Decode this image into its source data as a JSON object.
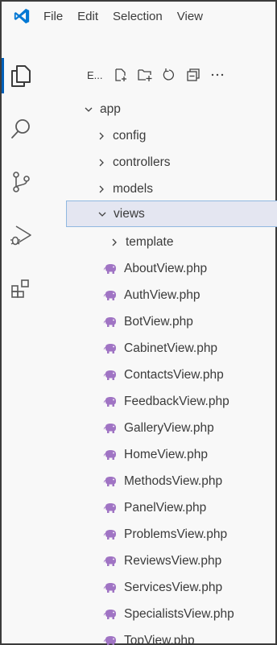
{
  "menu": [
    "File",
    "Edit",
    "Selection",
    "View"
  ],
  "activity": {
    "items": [
      "explorer-icon",
      "search-icon",
      "source-control-icon",
      "run-debug-icon",
      "extensions-icon"
    ],
    "accent": "#005fb8"
  },
  "explorer": {
    "title": "E..."
  },
  "tree": {
    "app": "app",
    "config": "config",
    "controllers": "controllers",
    "models": "models",
    "views": "views",
    "template": "template",
    "files": [
      "AboutView.php",
      "AuthView.php",
      "BotView.php",
      "CabinetView.php",
      "ContactsView.php",
      "FeedbackView.php",
      "GalleryView.php",
      "HomeView.php",
      "MethodsView.php",
      "PanelView.php",
      "ProblemsView.php",
      "ReviewsView.php",
      "ServicesView.php",
      "SpecialistsView.php",
      "TopView.php"
    ]
  },
  "colors": {
    "selection_bg": "#e4e6f1",
    "selection_border": "#90b8e0",
    "php_icon": "#a074c4"
  }
}
